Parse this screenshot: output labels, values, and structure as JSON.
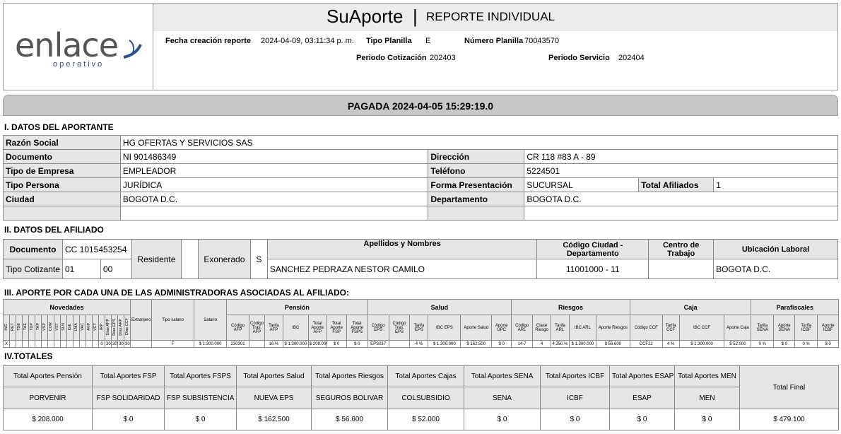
{
  "header": {
    "logo_text": "enlace",
    "logo_sub": "operativo",
    "app_title": "SuAporte",
    "separator": "|",
    "report_title": "REPORTE INDIVIDUAL",
    "fecha_label": "Fecha creación reporte",
    "fecha_value": "2024-04-09, 03:11:34 p. m.",
    "tipo_planilla_label": "Tipo Planilla",
    "tipo_planilla_value": "E",
    "numero_planilla_label": "Número Planilla",
    "numero_planilla_value": "70043570",
    "periodo_cotizacion_label": "Periodo Cotización",
    "periodo_cotizacion_value": "202403",
    "periodo_servicio_label": "Periodo Servicio",
    "periodo_servicio_value": "202404"
  },
  "status": "PAGADA 2024-04-05 15:29:19.0",
  "aportante": {
    "title": "I. DATOS DEL APORTANTE",
    "razon_social_label": "Razón Social",
    "razon_social": "HG OFERTAS Y SERVICIOS SAS",
    "documento_label": "Documento",
    "documento": "NI 901486349",
    "direccion_label": "Dirección",
    "direccion": "CR 118 #83 A - 89",
    "tipo_empresa_label": "Tipo de Empresa",
    "tipo_empresa": "EMPLEADOR",
    "telefono_label": "Teléfono",
    "telefono": "5224501",
    "tipo_persona_label": "Tipo Persona",
    "tipo_persona": "JURÍDICA",
    "forma_label": "Forma Presentación",
    "forma": "SUCURSAL",
    "total_afiliados_label": "Total Afiliados",
    "total_afiliados": "1",
    "ciudad_label": "Ciudad",
    "ciudad": "BOGOTA D.C.",
    "departamento_label": "Departamento",
    "departamento": "BOGOTA D.C."
  },
  "afiliado": {
    "title": "II. DATOS DEL AFILIADO",
    "documento_label": "Documento",
    "documento": "CC 1015453254",
    "tipo_cotizante_label": "Tipo Cotizante",
    "tipo_cotizante": "01",
    "subtipo": "00",
    "residente_label": "Residente",
    "residente": "",
    "exonerado_label": "Exonerado",
    "exonerado": "S",
    "nombres_label": "Apellidos y Nombres",
    "nombres": "SANCHEZ PEDRAZA NESTOR CAMILO",
    "codigo_ciudad_label": "Código Ciudad - Departamento",
    "codigo_ciudad": "11001000 - 11",
    "centro_label": "Centro de Trabajo",
    "centro": "",
    "ubicacion_label": "Ubicación Laboral",
    "ubicacion": "BOGOTA D.C."
  },
  "aportes": {
    "title": "III. APORTE POR CADA UNA DE LAS ADMINISTRADORAS ASOCIADAS AL AFILIADO:",
    "groups": {
      "novedades": "Novedades",
      "extranjero": "Extranjero",
      "tipo_salario": "Tipo salario",
      "salario": "Salario",
      "pension": "Pensión",
      "salud": "Salud",
      "riesgos": "Riesgos",
      "caja": "Caja",
      "parafiscales": "Parafiscales"
    },
    "novedades_cols": [
      "ING",
      "RET",
      "TDE",
      "TAE",
      "TDP",
      "TAP",
      "VSP",
      "COR",
      "VST",
      "SLN",
      "IGE",
      "LMA",
      "VAC",
      "AVP",
      "VCT",
      "IRP",
      "Días AFP",
      "Días EPS",
      "Días ARP",
      "Días CCF"
    ],
    "novedades_vals": [
      "X",
      "",
      "",
      "",
      "",
      "",
      "",
      "",
      "",
      "",
      "",
      "",
      "",
      "",
      "",
      "0",
      "30",
      "30",
      "30",
      "30"
    ],
    "extranjero": "",
    "tipo_salario": "F",
    "salario": "$ 1.300.000",
    "pension_cols": [
      "Código AFP",
      "Código Tras. AFP",
      "Tarifa AFP",
      "IBC",
      "Total Aporte AFP",
      "Total Aporte FSP",
      "Total Aporte FSPS"
    ],
    "pension_vals": [
      "230301",
      "",
      "16 %",
      "$ 1.300.000",
      "$ 208.000",
      "$ 0",
      "$ 0"
    ],
    "salud_cols": [
      "Código EPS",
      "Código Tras. EPS",
      "Tarifa EPS",
      "IBC EPS",
      "Aporte Salud",
      "Aporte UPC"
    ],
    "salud_vals": [
      "EPS037",
      "",
      "4 %",
      "$ 1.300.000",
      "$ 162.500",
      "$ 0"
    ],
    "riesgos_cols": [
      "Código ARL",
      "Clase Riesgo",
      "Tarifa ARL",
      "IBC ARL",
      "Aporte Riesgos"
    ],
    "riesgos_vals": [
      "14-7",
      "4",
      "4,350 %",
      "$ 1.300.000",
      "$ 56.600"
    ],
    "caja_cols": [
      "Código CCF",
      "Tarifa CCF",
      "IBC CCF",
      "Aporte Caja"
    ],
    "caja_vals": [
      "CCF22",
      "4 %",
      "$ 1.300.000",
      "$ 52.000"
    ],
    "para_cols": [
      "Tarifa SENA",
      "Aporte SENA",
      "Tarifa ICBF",
      "Aporte ICBF"
    ],
    "para_vals": [
      "0 %",
      "$ 0",
      "0 %",
      "$ 0"
    ]
  },
  "totales": {
    "title": "IV.TOTALES",
    "headers": [
      "Total Aportes Pensión",
      "Total Aportes FSP",
      "Total Aportes FSPS",
      "Total Aportes Salud",
      "Total Aportes Riesgos",
      "Total Aportes Cajas",
      "Total Aportes SENA",
      "Total Aportes ICBF",
      "Total Aportes ESAP",
      "Total Aportes MEN"
    ],
    "entities": [
      "PORVENIR",
      "FSP SOLIDARIDAD",
      "FSP SUBSISTENCIA",
      "NUEVA EPS",
      "SEGUROS BOLIVAR",
      "COLSUBSIDIO",
      "SENA",
      "ICBF",
      "ESAP",
      "MEN"
    ],
    "values": [
      "$ 208.000",
      "$ 0",
      "$ 0",
      "$ 162.500",
      "$ 56.600",
      "$ 52.000",
      "$ 0",
      "$ 0",
      "$ 0",
      "$ 0"
    ],
    "total_final_label": "Total Final",
    "total_final": "$ 479.100"
  }
}
